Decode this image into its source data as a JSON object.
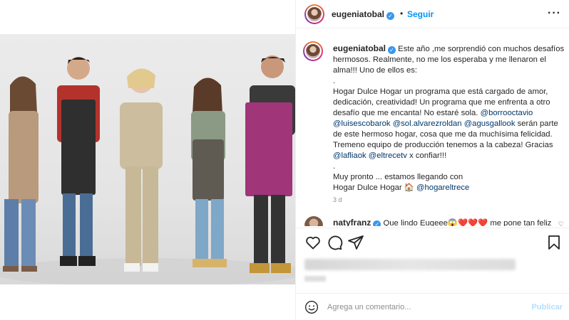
{
  "header": {
    "username": "eugeniatobal",
    "separator": "•",
    "follow_label": "Seguir",
    "more_label": "···"
  },
  "caption": {
    "username": "eugeniatobal",
    "lines": [
      "Este año ,me sorprendió con muchos desafíos hermosos. Realmente, no me los esperaba y me llenaron el alma!!! Uno de ellos es:",
      ".",
      "Hogar Dulce Hogar un programa que está cargado de amor, dedicación, creatividad! Un programa que me enfrenta a otro desafío que me encanta! No estaré sola."
    ],
    "mentions_a": [
      "@borrooctavio",
      "@luisescobarok",
      "@sol.alvarezroldan",
      "@agusgallook"
    ],
    "text_b": " serán parte de este hermoso hogar, cosa que me da muchísima felicidad. Tremeno equipo de producción tenemos a la cabeza! Gracias ",
    "mention_lafliaok": "@lafliaok",
    "mention_eltrece": "@eltrecetv",
    "text_c": " x confiar!!!",
    "dot2": ".",
    "closing_1": "Muy pronto ... estamos llegando con",
    "closing_2": "Hogar Dulce Hogar 🏠 ",
    "mention_hogar": "@hogareltrece",
    "time": "3 d"
  },
  "comment2": {
    "username": "natyfranz",
    "text": "Que lindo Eugeee😱❤️❤️❤️  me pone tan feliz"
  },
  "composer": {
    "placeholder": "Agrega un comentario...",
    "publish_label": "Publicar"
  },
  "colors": {
    "accent": "#0095f6",
    "mention": "#00376b",
    "muted": "#8e8e8e",
    "verified": "#3897f0"
  },
  "icons": [
    "verified-badge-icon",
    "more-options-icon",
    "heart-icon",
    "comment-icon",
    "share-icon",
    "bookmark-icon",
    "emoji-icon",
    "house-emoji"
  ]
}
